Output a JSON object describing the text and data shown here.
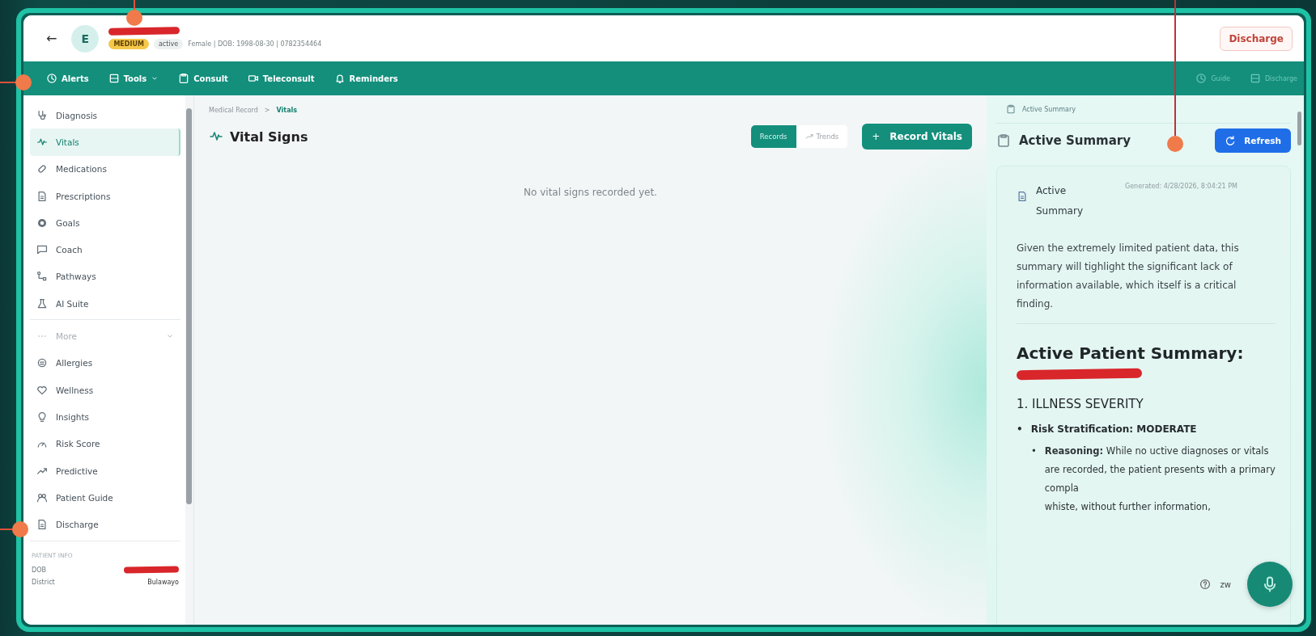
{
  "header": {
    "back": "←",
    "avatar": "E",
    "badges": [
      {
        "label": "MEDIUM",
        "kind": "risk"
      },
      {
        "label": "active",
        "kind": "status"
      }
    ],
    "meta": "Female | DOB: 1998-08-30 | 0782354464",
    "discharge": "Discharge"
  },
  "toolbar": {
    "items": [
      {
        "label": "Alerts",
        "dropdown": false
      },
      {
        "label": "Tools",
        "dropdown": true
      },
      {
        "label": "Consult",
        "dropdown": false
      },
      {
        "label": "Teleconsult",
        "dropdown": false
      },
      {
        "label": "Reminders",
        "dropdown": false
      }
    ],
    "right_items": [
      {
        "label": "Guide"
      },
      {
        "label": "Discharge"
      }
    ]
  },
  "sidebar": {
    "items": [
      {
        "label": "Diagnosis",
        "selected": false
      },
      {
        "label": "Vitals",
        "selected": true
      },
      {
        "label": "Medications",
        "selected": false
      },
      {
        "label": "Prescriptions",
        "selected": false
      },
      {
        "label": "Goals",
        "selected": false
      },
      {
        "label": "Coach",
        "selected": false
      },
      {
        "label": "Pathways",
        "selected": false
      },
      {
        "label": "AI Suite",
        "selected": false
      }
    ],
    "more": {
      "label": "More",
      "expanded": true
    },
    "more_items": [
      {
        "label": "Allergies",
        "selected": false
      },
      {
        "label": "Wellness",
        "selected": false
      },
      {
        "label": "Insights",
        "selected": false
      },
      {
        "label": "Risk Score",
        "selected": false
      },
      {
        "label": "Predictive",
        "selected": false
      },
      {
        "label": "Patient Guide",
        "selected": false
      },
      {
        "label": "Discharge",
        "selected": false
      }
    ],
    "patient_info": {
      "heading": "PATIENT INFO",
      "rows": [
        {
          "label": "DOB",
          "redacted": true
        },
        {
          "label": "District",
          "value": "Bulawayo"
        }
      ]
    }
  },
  "main": {
    "breadcrumb": [
      "Medical Record",
      "Vitals"
    ],
    "breadcrumb_separator": ">",
    "title": "Vital Signs",
    "views": [
      {
        "label": "Records",
        "selected": true
      },
      {
        "label": "Trends",
        "selected": false
      }
    ],
    "record_button": "Record Vitals",
    "record_button_icon": "+",
    "empty": "No vital signs recorded yet."
  },
  "summary_panel": {
    "crumb": "Active Summary",
    "title": "Active Summary",
    "refresh": "Refresh",
    "card": {
      "title": "Active Summary",
      "generated": "Generated: 4/28/2026, 8:04:21 PM",
      "intro": "Given the extremely limited patient data, this summary will tighlight the significant lack of information available, which itself is a critical finding.",
      "heading": "Active Patient Summary:",
      "section": "1. ILLNESS SEVERITY",
      "bullet_marker": "•",
      "bullet": "Risk Stratification: MODERATE",
      "reasoning": "**Reasoning:** While no uctive diagnoses or vitals are recorded, the patient presents with a primary compla",
      "reasoning_cont": "whiste, without further information,"
    },
    "widget": {
      "label": "zw"
    }
  }
}
